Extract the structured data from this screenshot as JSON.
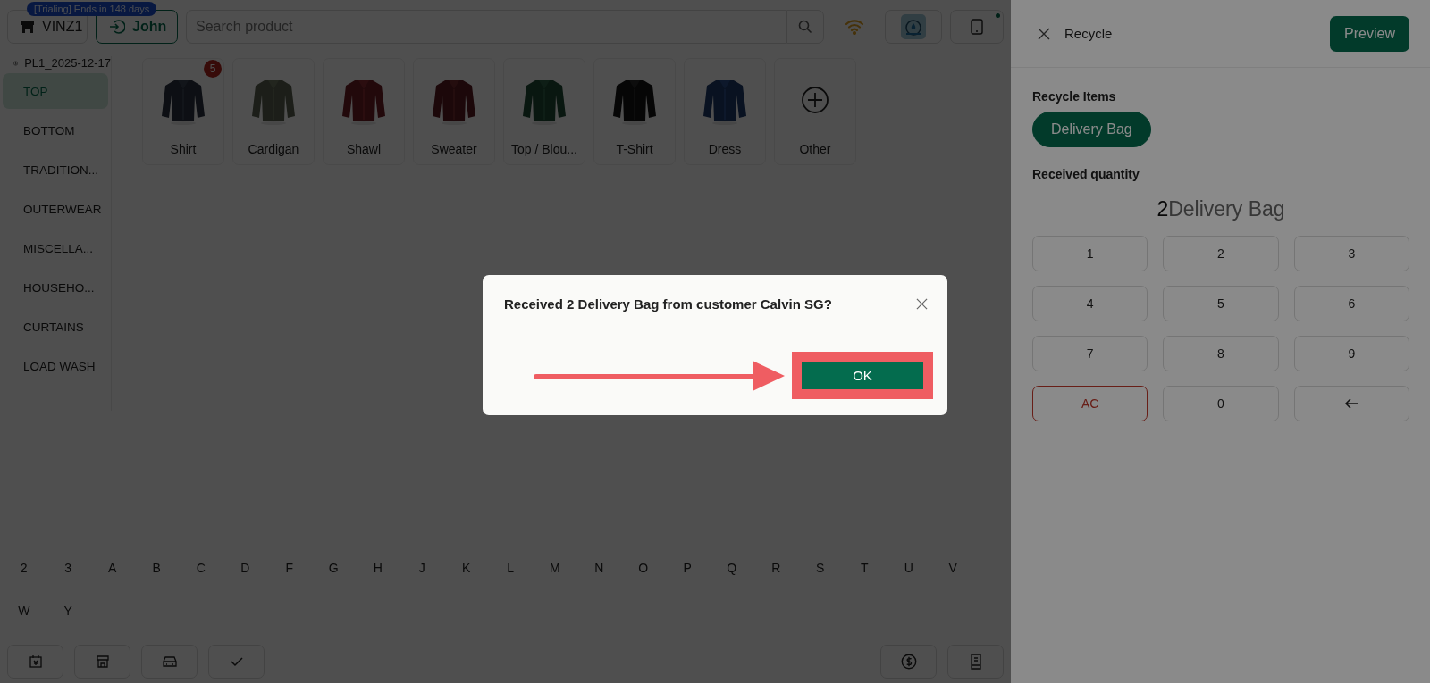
{
  "trial_badge": "[Trialing] Ends in 148 days",
  "store_button": {
    "label": "VINZ1"
  },
  "staff_button": {
    "label": "John"
  },
  "search": {
    "placeholder": "Search product"
  },
  "price_list": "PL1_2025-12-17",
  "categories": [
    {
      "label": "TOP",
      "selected": true
    },
    {
      "label": "BOTTOM",
      "selected": false
    },
    {
      "label": "TRADITION...",
      "selected": false
    },
    {
      "label": "OUTERWEAR",
      "selected": false
    },
    {
      "label": "MISCELLA...",
      "selected": false
    },
    {
      "label": "HOUSEHO...",
      "selected": false
    },
    {
      "label": "CURTAINS",
      "selected": false
    },
    {
      "label": "LOAD WASH",
      "selected": false
    }
  ],
  "products": [
    {
      "name": "Shirt",
      "kind": "picture",
      "badge": "5"
    },
    {
      "name": "Cardigan",
      "kind": "picture"
    },
    {
      "name": "Shawl",
      "kind": "picture"
    },
    {
      "name": "Sweater",
      "kind": "picture"
    },
    {
      "name": "Top / Blou...",
      "kind": "picture"
    },
    {
      "name": "T-Shirt",
      "kind": "picture"
    },
    {
      "name": "Dress",
      "kind": "picture"
    },
    {
      "name": "Other",
      "kind": "add"
    }
  ],
  "letter_index": [
    "2",
    "3",
    "A",
    "B",
    "C",
    "D",
    "F",
    "G",
    "H",
    "J",
    "K",
    "L",
    "M",
    "N",
    "O",
    "P",
    "Q",
    "R",
    "S",
    "T",
    "U",
    "V",
    "W",
    "Y"
  ],
  "drawer": {
    "title": "Recycle",
    "preview_button": "Preview",
    "items_heading": "Recycle Items",
    "items": [
      {
        "label": "Delivery Bag",
        "selected": true
      }
    ],
    "quantity_heading": "Received quantity",
    "quantity": {
      "value": "2",
      "unit": "Delivery Bag"
    },
    "keypad": [
      {
        "kind": "digit",
        "label": "1"
      },
      {
        "kind": "digit",
        "label": "2"
      },
      {
        "kind": "digit",
        "label": "3"
      },
      {
        "kind": "digit",
        "label": "4"
      },
      {
        "kind": "digit",
        "label": "5"
      },
      {
        "kind": "digit",
        "label": "6"
      },
      {
        "kind": "digit",
        "label": "7"
      },
      {
        "kind": "digit",
        "label": "8"
      },
      {
        "kind": "digit",
        "label": "9"
      },
      {
        "kind": "clear",
        "label": "AC"
      },
      {
        "kind": "digit",
        "label": "0"
      },
      {
        "kind": "backspace"
      }
    ]
  },
  "dialog": {
    "message": "Received 2 Delivery Bag from customer Calvin SG?",
    "ok_button": "OK"
  }
}
